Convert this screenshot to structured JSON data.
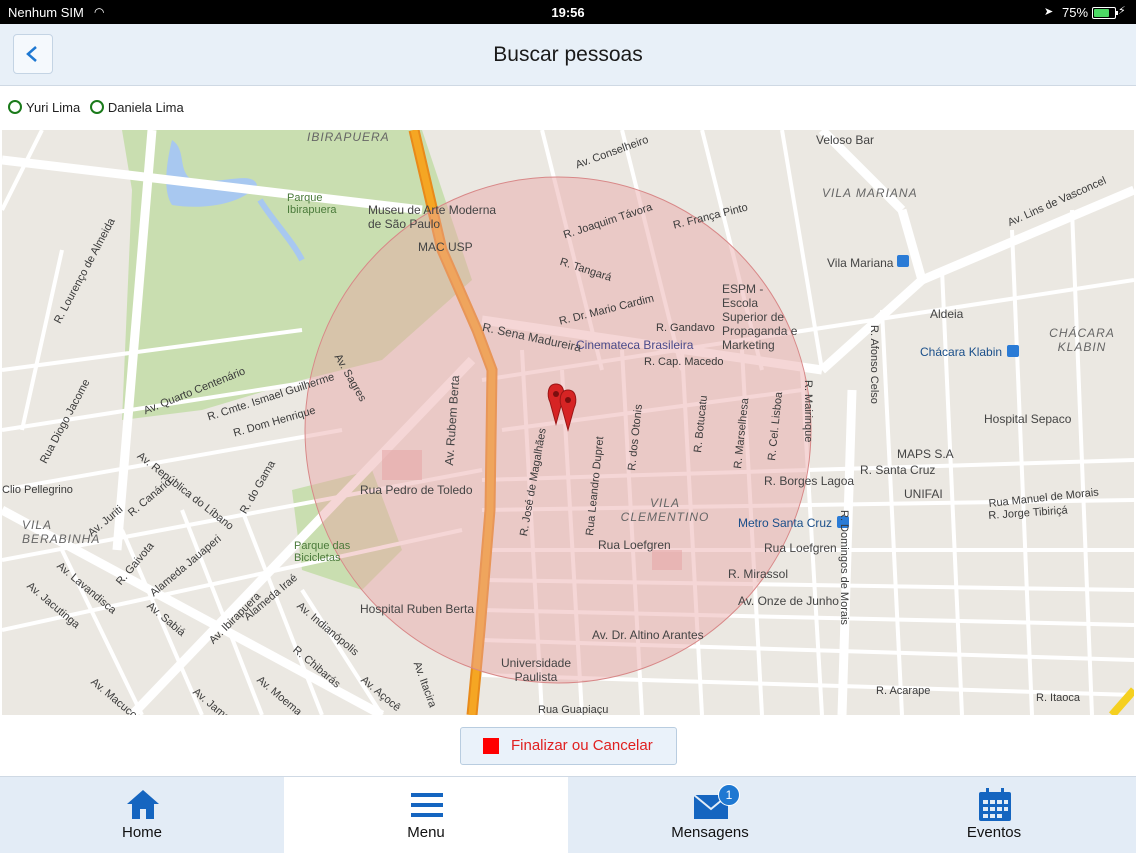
{
  "status_bar": {
    "carrier": "Nenhum SIM",
    "time": "19:56",
    "battery": "75%"
  },
  "header": {
    "title": "Buscar pessoas",
    "back_icon": "chevron-left-icon"
  },
  "participants": [
    {
      "name": "Yuri Lima",
      "color": "#1a7a1a"
    },
    {
      "name": "Daniela Lima",
      "color": "#1a7a1a"
    }
  ],
  "map": {
    "labels": {
      "ibirapuera": "IBIRAPUERA",
      "parque_ibirapuera": "Parque Ibirapuera",
      "museu": "Museu de Arte Moderna de São Paulo",
      "mac_usp": "MAC USP",
      "vila_mariana": "VILA MARIANA",
      "vila_mariana_station": "Vila Mariana",
      "veloso_bar": "Veloso Bar",
      "espm": "ESPM - Escola Superior de Propaganda e Marketing",
      "aldeia": "Aldeia",
      "chacara_klabin_area": "CHÁCARA KLABIN",
      "chacara_klabin": "Chácara Klabin",
      "hospital_sepaco": "Hospital Sepaco",
      "maps_sa": "MAPS S.A",
      "unifai": "UNIFAI",
      "metro_santa_cruz": "Metro Santa Cruz",
      "cinemateca": "Cinemateca Brasileira",
      "vila_clementino": "VILA CLEMENTINO",
      "vila_berabinha": "VILA BERABINHA",
      "parque_bicicletas": "Parque das Bicicletas",
      "hospital_ruben_berta": "Hospital Ruben Berta",
      "universidade_paulista": "Universidade Paulista",
      "rua_pedro_toledo": "Rua Pedro de Toledo",
      "av_rubem_berta": "Av. Rubem Berta",
      "r_sena_madureira": "R. Sena Madureira",
      "rua_loefgren": "Rua Loefgren",
      "r_mirassol": "R. Mirassol",
      "av_onze_junho": "Av. Onze de Junho",
      "av_altino_arantes": "Av. Dr. Altino Arantes",
      "r_borges_lagoa": "R. Borges Lagoa",
      "r_santa_cruz": "R. Santa Cruz",
      "av_republica_libano": "Av. República do Líbano",
      "av_ibirapuera": "Av. Ibirapuera",
      "av_indianopolis": "Av. Indianópolis",
      "r_domingos_morais": "R. Domingos de Morais",
      "r_joaquim_tavora": "R. Joaquim Távora",
      "r_tangara": "R. Tangará",
      "r_dr_mario_cardim": "R. Dr. Mario Cardim",
      "r_gandavo": "R. Gandavo",
      "r_cap_macedo": "R. Cap. Macedo",
      "av_conselheiro": "Av. Conselheiro",
      "r_franca_pinto": "R. França Pinto",
      "av_lins_vasconcelos": "Av. Lins de Vasconcel",
      "r_jose_magalhaes": "R. José de Magalhães",
      "rua_leandro_dupret": "Rua Leandro Dupret",
      "r_dos_otonis": "R. dos Otonis",
      "r_botucatu": "R. Botucatu",
      "r_marselhesa": "R. Marselhesa",
      "r_cel_lisboa": "R. Cel. Lisboa",
      "r_mairinque": "R. Mairinque",
      "r_afonso_celso": "R. Afonso Celso",
      "rua_manuel_morais": "Rua Manuel de Morais",
      "r_jorge_tibirica": "R. Jorge Tibiriçá",
      "r_acarape": "R. Acarape",
      "r_itaoca": "R. Itaoca",
      "rua_guapiacu": "Rua Guapiaçu",
      "r_dom_henrique": "R. Dom Henrique",
      "r_cmte_ismael": "R. Cmte. Ismael Guilherme",
      "av_quarto_centenario": "Av. Quarto Centenário",
      "r_lourenco_almeida": "R. Lourenço de Almeida",
      "rua_diogo_jacome": "Rua Diogo Jacome",
      "alameda_jauaperi": "Alameda Jauaperi",
      "r_do_gama": "R. do Gama",
      "av_sagres": "Av. Sagres",
      "clio_pellegrino": "Clio Pellegrino",
      "r_canario": "R. Canário",
      "av_juriti": "Av. Juriti",
      "r_gaivota": "R. Gaivota",
      "av_lavandisca": "Av. Lavandisca",
      "av_jacutinga": "Av. Jacutinga",
      "av_sabia": "Av. Sabiá",
      "alameda_irae": "Alameda Iraé",
      "av_moema": "Av. Moema",
      "av_macuco": "Av. Macuco",
      "av_jamaris": "Av. Jamaris",
      "r_chibaras": "R. Chibarás",
      "av_acoce": "Av. Açocê",
      "av_itacira": "Av. Itacira",
      "rua_loefgren_2": "Rua Loefgren"
    },
    "pin_color": "#d62424",
    "radius_fill": "#e8a0a0"
  },
  "actions": {
    "finish_label": "Finalizar ou Cancelar"
  },
  "tabbar": {
    "items": [
      {
        "label": "Home",
        "icon": "home-icon"
      },
      {
        "label": "Menu",
        "icon": "menu-icon"
      },
      {
        "label": "Mensagens",
        "icon": "envelope-icon",
        "badge": "1"
      },
      {
        "label": "Eventos",
        "icon": "calendar-icon"
      }
    ],
    "accent": "#1565c0"
  }
}
